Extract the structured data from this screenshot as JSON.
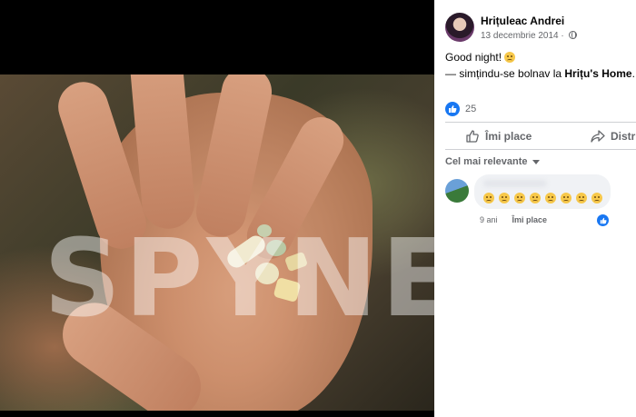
{
  "post": {
    "author": "Hrițuleac Andrei",
    "date": "13 decembrie 2014",
    "privacy_icon": "globe-icon",
    "text_line1": "Good night!",
    "text_line2_prefix": "— simțindu-se bolnav la ",
    "text_line2_place": "Hrițu's Home",
    "text_line2_suffix": "."
  },
  "photo": {
    "watermark": "SPYNE"
  },
  "reactions": {
    "count": "25"
  },
  "actions": {
    "like_label": "Îmi place",
    "share_label": "Distri"
  },
  "comments": {
    "sort_label": "Cel mai relevante",
    "items": [
      {
        "emoji_count": 8,
        "age": "9 ani",
        "like_label": "Îmi place"
      }
    ]
  },
  "colors": {
    "accent": "#1877f2",
    "secondary_text": "#65676b",
    "primary_text": "#050505"
  }
}
